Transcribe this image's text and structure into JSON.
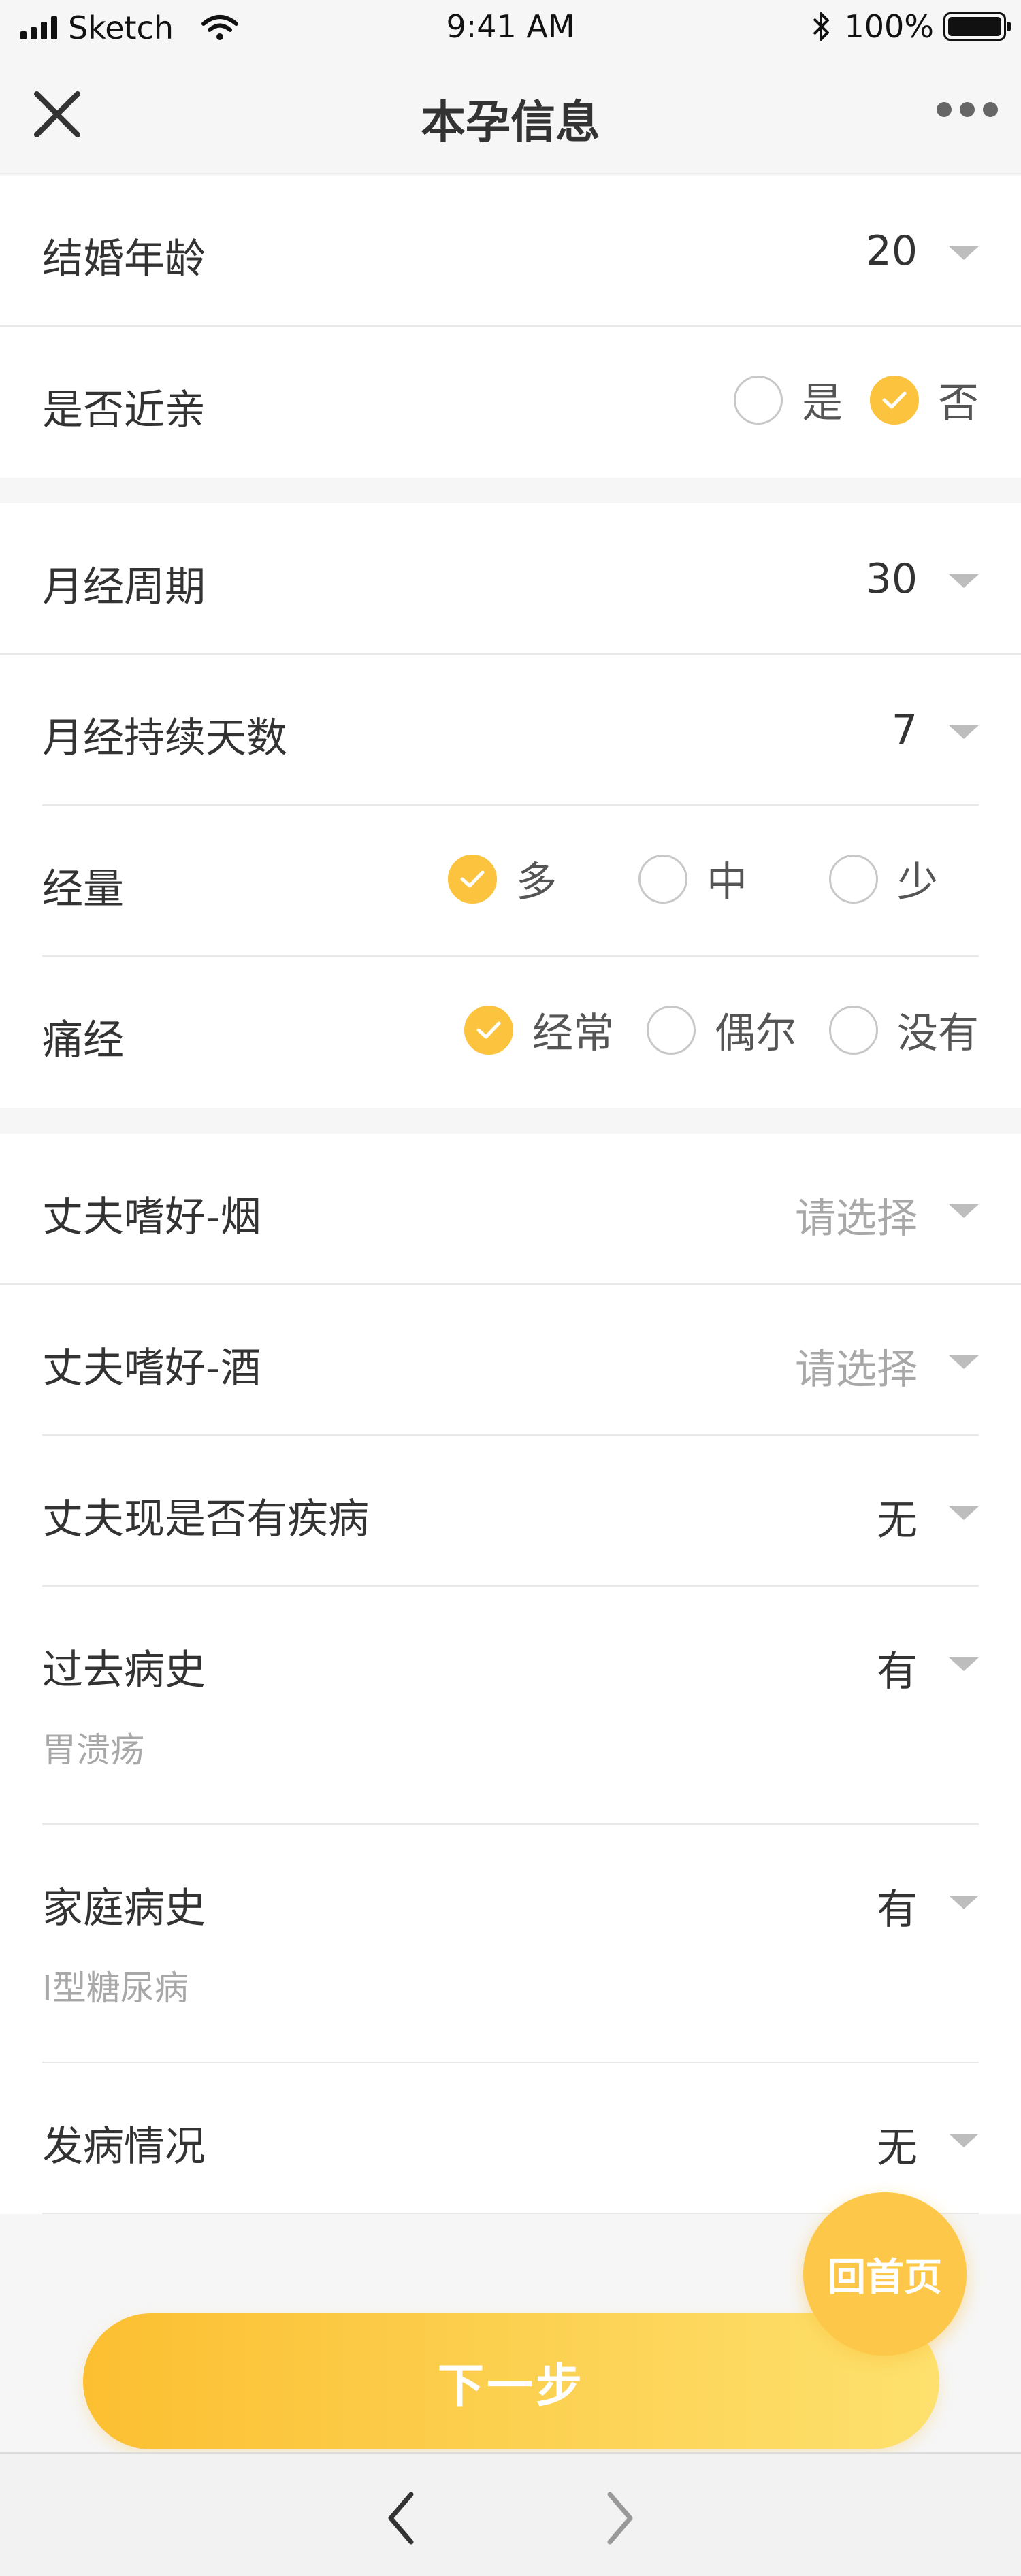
{
  "status_bar": {
    "carrier": "Sketch",
    "time": "9:41 AM",
    "battery": "100%"
  },
  "nav": {
    "title": "本孕信息"
  },
  "section1": {
    "marriage_age": {
      "label": "结婚年龄",
      "value": "20"
    },
    "consanguinity": {
      "label": "是否近亲",
      "options": [
        "是",
        "否"
      ],
      "selected": "否"
    }
  },
  "section2": {
    "cycle": {
      "label": "月经周期",
      "value": "30"
    },
    "duration": {
      "label": "月经持续天数",
      "value": "7"
    },
    "volume": {
      "label": "经量",
      "options": [
        "多",
        "中",
        "少"
      ],
      "selected": "多"
    },
    "dysmenorrhea": {
      "label": "痛经",
      "options": [
        "经常",
        "偶尔",
        "没有"
      ],
      "selected": "经常"
    }
  },
  "section3": {
    "husband_smoke": {
      "label": "丈夫嗜好-烟",
      "placeholder": "请选择"
    },
    "husband_drink": {
      "label": "丈夫嗜好-酒",
      "placeholder": "请选择"
    },
    "husband_disease": {
      "label": "丈夫现是否有疾病",
      "value": "无"
    },
    "past_history": {
      "label": "过去病史",
      "value": "有",
      "detail": "胃溃疡"
    },
    "family_history": {
      "label": "家庭病史",
      "value": "有",
      "detail": "I型糖尿病"
    },
    "onset": {
      "label": "发病情况",
      "value": "无"
    }
  },
  "actions": {
    "home_label": "回首页",
    "next_label": "下一步"
  },
  "colors": {
    "accent": "#fcc33f",
    "placeholder": "#a8a8a8"
  }
}
